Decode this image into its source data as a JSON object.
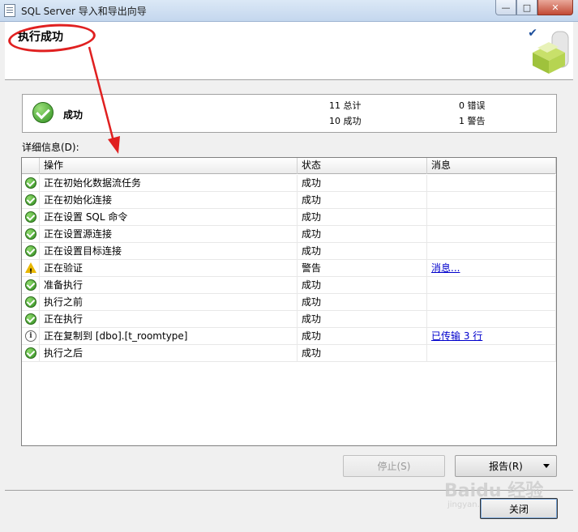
{
  "window": {
    "title": "SQL Server 导入和导出向导",
    "min": "—",
    "max": "□",
    "close": "✕"
  },
  "header": {
    "title": "执行成功",
    "check": "✔"
  },
  "summary": {
    "status": "成功",
    "total_num": "11",
    "total_label": "总计",
    "success_num": "10",
    "success_label": "成功",
    "error_num": "0",
    "error_label": "错误",
    "warning_num": "1",
    "warning_label": "警告"
  },
  "details_label": "详细信息(D):",
  "table": {
    "columns": [
      "操作",
      "状态",
      "消息"
    ],
    "rows": [
      {
        "icon": "ok",
        "op": "正在初始化数据流任务",
        "status": "成功",
        "msg": ""
      },
      {
        "icon": "ok",
        "op": "正在初始化连接",
        "status": "成功",
        "msg": ""
      },
      {
        "icon": "ok",
        "op": "正在设置 SQL 命令",
        "status": "成功",
        "msg": ""
      },
      {
        "icon": "ok",
        "op": "正在设置源连接",
        "status": "成功",
        "msg": ""
      },
      {
        "icon": "ok",
        "op": "正在设置目标连接",
        "status": "成功",
        "msg": ""
      },
      {
        "icon": "warn",
        "op": "正在验证",
        "status": "警告",
        "msg": "消息..."
      },
      {
        "icon": "ok",
        "op": "准备执行",
        "status": "成功",
        "msg": ""
      },
      {
        "icon": "ok",
        "op": "执行之前",
        "status": "成功",
        "msg": ""
      },
      {
        "icon": "ok",
        "op": "正在执行",
        "status": "成功",
        "msg": ""
      },
      {
        "icon": "info",
        "op": "正在复制到 [dbo].[t_roomtype]",
        "status": "成功",
        "msg": "已传输 3 行"
      },
      {
        "icon": "ok",
        "op": "执行之后",
        "status": "成功",
        "msg": ""
      }
    ]
  },
  "buttons": {
    "stop": "停止(S)",
    "report": "报告(R)",
    "close": "关闭"
  },
  "watermark": {
    "main": "Baidu 经验",
    "sub": "jingyan.baidu.com"
  }
}
